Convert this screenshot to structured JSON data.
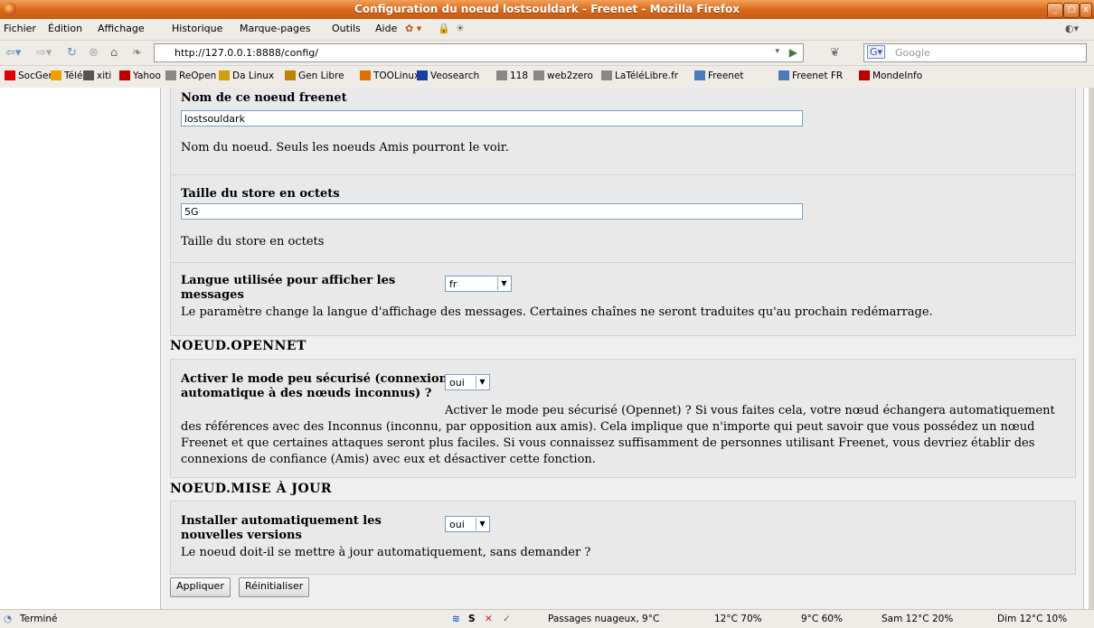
{
  "window": {
    "title": "Configuration du noeud lostsouldark - Freenet - Mozilla Firefox"
  },
  "menu": [
    "Fichier",
    "Édition",
    "Affichage",
    "Historique",
    "Marque-pages",
    "Outils",
    "Aide"
  ],
  "nav": {
    "url": "http://127.0.0.1:8888/config/",
    "search_placeholder": "Google"
  },
  "bookmarks": [
    {
      "label": "SocGen",
      "color": "#e00000"
    },
    {
      "label": "Télé",
      "color": "#f0a000"
    },
    {
      "label": "xiti",
      "color": "#555555"
    },
    {
      "label": "Yahoo",
      "color": "#c00000"
    },
    {
      "label": "ReOpen",
      "color": "#888888"
    },
    {
      "label": "Da Linux",
      "color": "#d0a000"
    },
    {
      "label": "Gen Libre",
      "color": "#c08000"
    },
    {
      "label": "TOOLinux",
      "color": "#e07000"
    },
    {
      "label": "Veosearch",
      "color": "#1a3fa0"
    },
    {
      "label": "118",
      "color": "#888888"
    },
    {
      "label": "web2zero",
      "color": "#888888"
    },
    {
      "label": "LaTéléLibre.fr",
      "color": "#888888"
    },
    {
      "label": "Freenet",
      "color": "#4a7ac0"
    },
    {
      "label": "Freenet FR",
      "color": "#4a7ac0"
    },
    {
      "label": "MondeInfo",
      "color": "#c00000"
    }
  ],
  "node": {
    "name_label": "Nom de ce noeud freenet",
    "name_value": "lostsouldark",
    "name_desc": "Nom du noeud. Seuls les noeuds Amis pourront le voir.",
    "store_label": "Taille du store en octets",
    "store_value": "5G",
    "store_desc": "Taille du store en octets",
    "lang_label": "Langue utilisée pour afficher les messages",
    "lang_value": "fr",
    "lang_desc": "Le paramètre change la langue d'affichage des messages. Certaines chaînes ne seront traduites qu'au prochain redémarrage."
  },
  "opennet": {
    "heading": "NOEUD.OPENNET",
    "label": "Activer le mode peu sécurisé (connexion automatique à des nœuds inconnus) ?",
    "value": "oui",
    "desc": "Activer le mode peu sécurisé (Opennet) ? Si vous faites cela, votre nœud échangera automatiquement des références avec des Inconnus (inconnu, par opposition aux amis). Cela implique que n'importe qui peut savoir que vous possédez un nœud Freenet et que certaines attaques seront plus faciles. Si vous connaissez suffisamment de personnes utilisant Freenet, vous devriez établir des connexions de confiance (Amis) avec eux et désactiver cette fonction."
  },
  "update": {
    "heading": "NOEUD.MISE À JOUR",
    "label": "Installer automatiquement les nouvelles versions",
    "value": "oui",
    "desc": "Le noeud doit-il se mettre à jour automatiquement, sans demander ?"
  },
  "buttons": {
    "apply": "Appliquer",
    "reset": "Réinitialiser"
  },
  "status": {
    "text": "Terminé",
    "weather": [
      "Passages nuageux, 9°C",
      "12°C 70%",
      "9°C 60%",
      "Sam 12°C 20%",
      "Dim 12°C 10%"
    ]
  }
}
